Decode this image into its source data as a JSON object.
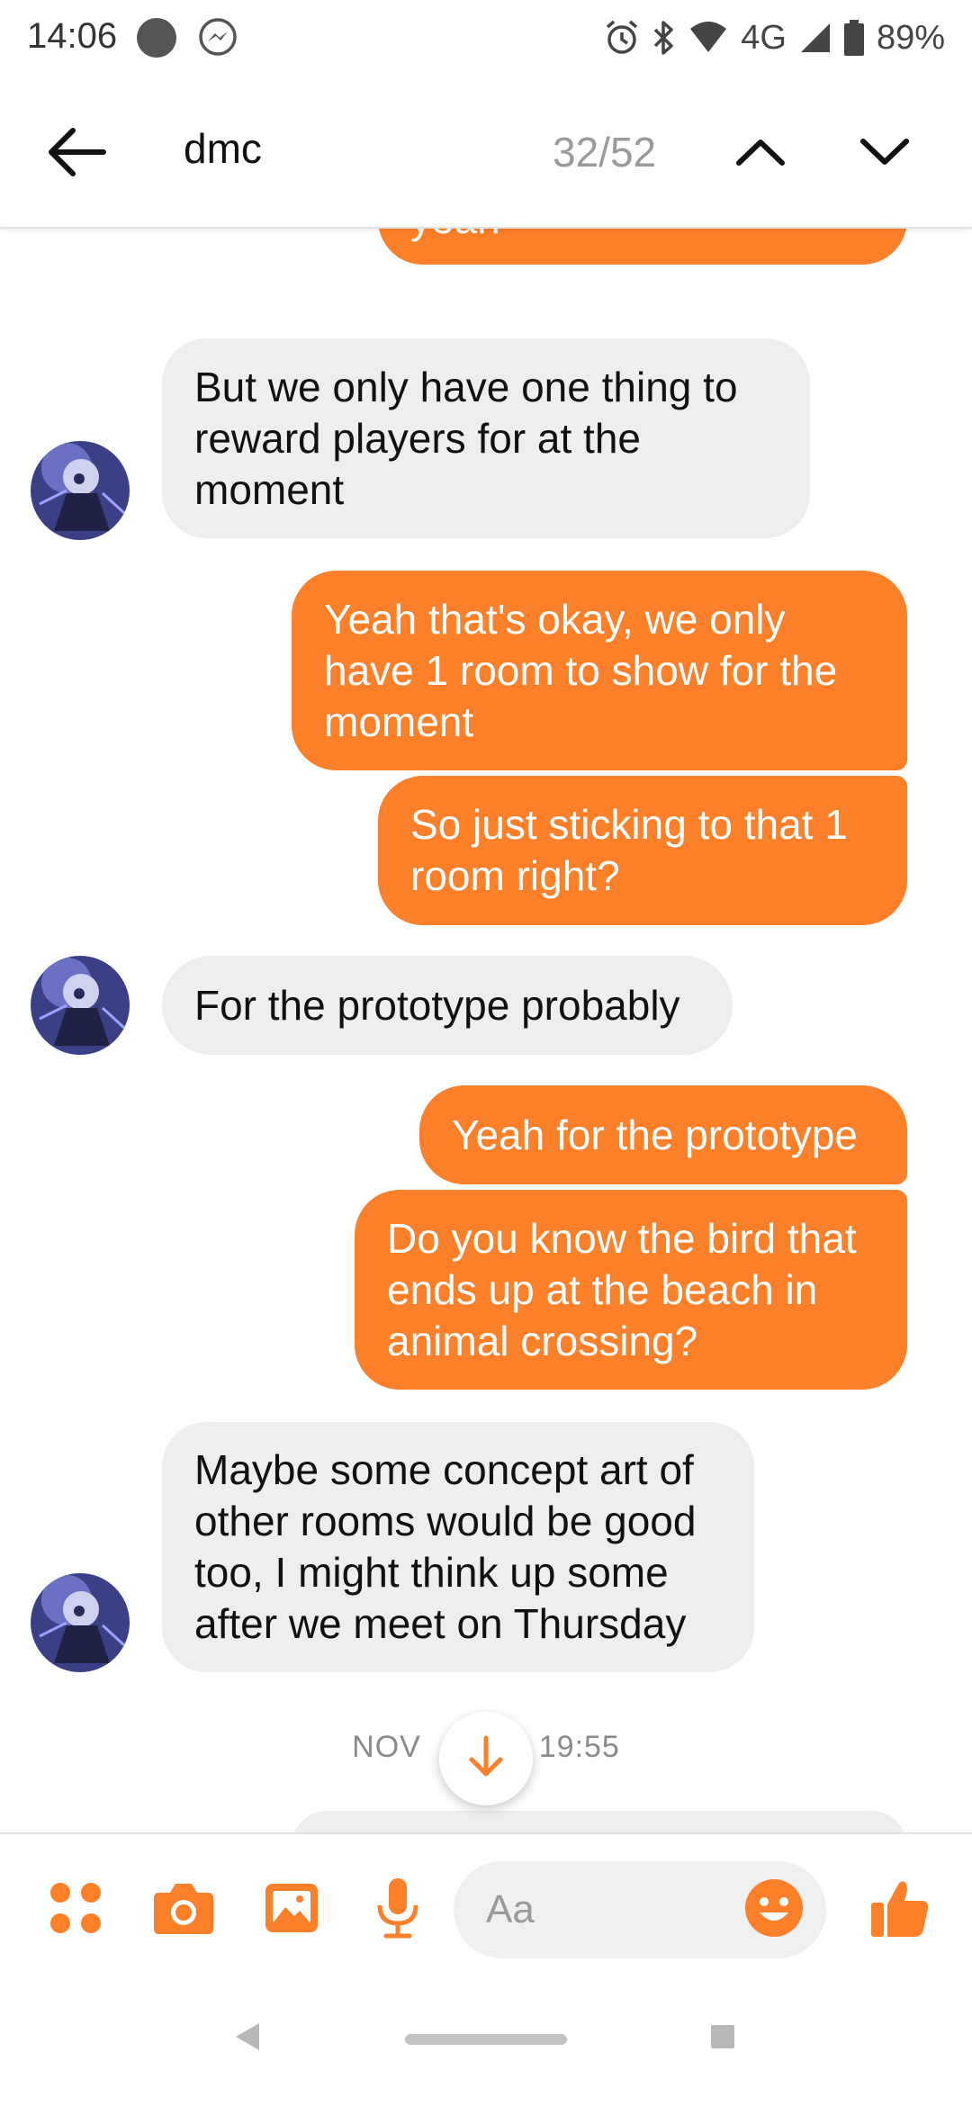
{
  "status_bar": {
    "time": "14:06",
    "network": "4G",
    "battery": "89%",
    "icons": [
      "notification-dot-icon",
      "messenger-icon",
      "alarm-icon",
      "bluetooth-icon",
      "wifi-icon",
      "signal-icon",
      "battery-icon"
    ]
  },
  "header": {
    "search_query": "dmc",
    "match_counter": "32/52",
    "icons": [
      "back-arrow-icon",
      "chevron-up-icon",
      "chevron-down-icon"
    ]
  },
  "messages": [
    {
      "direction": "out",
      "text": "yeah"
    },
    {
      "direction": "in",
      "text": "But we only have one thing to reward players for at the moment"
    },
    {
      "direction": "out",
      "text": "Yeah that's okay, we only have 1 room to show for the moment"
    },
    {
      "direction": "out",
      "text": "So just sticking to that 1 room right?"
    },
    {
      "direction": "in",
      "text": "For the prototype probably"
    },
    {
      "direction": "out",
      "text": "Yeah for the prototype"
    },
    {
      "direction": "out",
      "text": "Do you know the bird that ends up at the beach in animal crossing?"
    },
    {
      "direction": "in",
      "text": "Maybe some concept art of other rooms would be good too, I might think up some after we meet on Thursday"
    }
  ],
  "timestamp": {
    "left": "NOV",
    "right": "19:55"
  },
  "composer": {
    "placeholder": "Aa",
    "icons": [
      "apps-grid-icon",
      "camera-icon",
      "gallery-icon",
      "microphone-icon",
      "emoji-icon",
      "thumbs-up-icon"
    ]
  },
  "colors": {
    "accent": "#fc7f29",
    "incoming_bubble": "#eeeeee"
  }
}
